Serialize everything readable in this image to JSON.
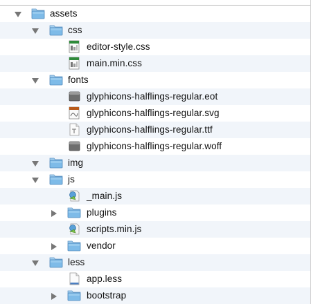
{
  "colors": {
    "row_alt": "#f1f5fa",
    "folder_body": "#7ebbe8",
    "folder_tab": "#a8d3f2",
    "disclosure": "#777777"
  },
  "tree": [
    {
      "label": "assets",
      "icon": "folder-icon",
      "expanded": true
    },
    {
      "label": "css",
      "icon": "folder-icon",
      "expanded": true
    },
    {
      "label": "editor-style.css",
      "icon": "css-file-icon"
    },
    {
      "label": "main.min.css",
      "icon": "css-file-icon"
    },
    {
      "label": "fonts",
      "icon": "folder-icon",
      "expanded": true
    },
    {
      "label": "glyphicons-halflings-regular.eot",
      "icon": "font-file-icon"
    },
    {
      "label": "glyphicons-halflings-regular.svg",
      "icon": "svg-file-icon"
    },
    {
      "label": "glyphicons-halflings-regular.ttf",
      "icon": "ttf-file-icon"
    },
    {
      "label": "glyphicons-halflings-regular.woff",
      "icon": "font-file-icon"
    },
    {
      "label": "img",
      "icon": "folder-icon",
      "expanded": true
    },
    {
      "label": "js",
      "icon": "folder-icon",
      "expanded": true
    },
    {
      "label": "_main.js",
      "icon": "js-file-icon"
    },
    {
      "label": "plugins",
      "icon": "folder-icon",
      "expanded": false
    },
    {
      "label": "scripts.min.js",
      "icon": "js-file-icon"
    },
    {
      "label": "vendor",
      "icon": "folder-icon",
      "expanded": false
    },
    {
      "label": "less",
      "icon": "folder-icon",
      "expanded": true
    },
    {
      "label": "app.less",
      "icon": "document-icon"
    },
    {
      "label": "bootstrap",
      "icon": "folder-icon",
      "expanded": false
    }
  ]
}
